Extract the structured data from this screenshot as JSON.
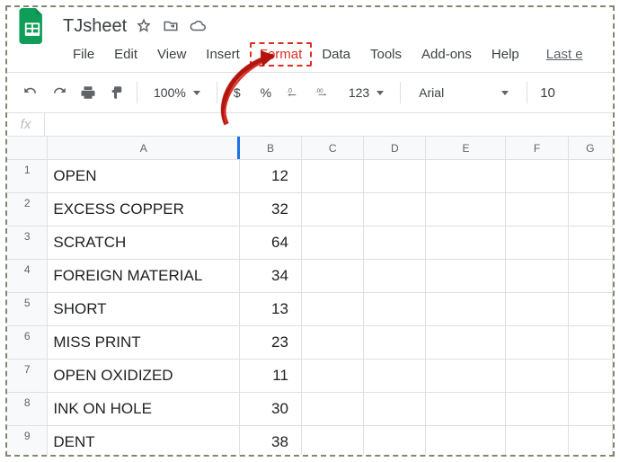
{
  "doc": {
    "title": "TJsheet"
  },
  "menus": {
    "file": "File",
    "edit": "Edit",
    "view": "View",
    "insert": "Insert",
    "format": "Format",
    "data": "Data",
    "tools": "Tools",
    "addons": "Add-ons",
    "help": "Help",
    "last_edit": "Last e"
  },
  "toolbar": {
    "zoom": "100%",
    "currency": "$",
    "percent": "%",
    "dec_dec": ".0",
    "inc_dec": ".00",
    "more_formats": "123",
    "font": "Arial",
    "font_size": "10"
  },
  "fx": {
    "label": "fx"
  },
  "columns": [
    "A",
    "B",
    "C",
    "D",
    "E",
    "F",
    "G"
  ],
  "rows": [
    {
      "n": "1",
      "a": "OPEN",
      "b": "12"
    },
    {
      "n": "2",
      "a": "EXCESS COPPER",
      "b": "32"
    },
    {
      "n": "3",
      "a": "SCRATCH",
      "b": "64"
    },
    {
      "n": "4",
      "a": "FOREIGN MATERIAL",
      "b": "34"
    },
    {
      "n": "5",
      "a": "SHORT",
      "b": "13"
    },
    {
      "n": "6",
      "a": "MISS PRINT",
      "b": "23"
    },
    {
      "n": "7",
      "a": "OPEN OXIDIZED",
      "b": "11"
    },
    {
      "n": "8",
      "a": "INK ON HOLE",
      "b": "30"
    },
    {
      "n": "9",
      "a": "DENT",
      "b": "38"
    }
  ],
  "annotation": {
    "highlight_menu": "format"
  }
}
